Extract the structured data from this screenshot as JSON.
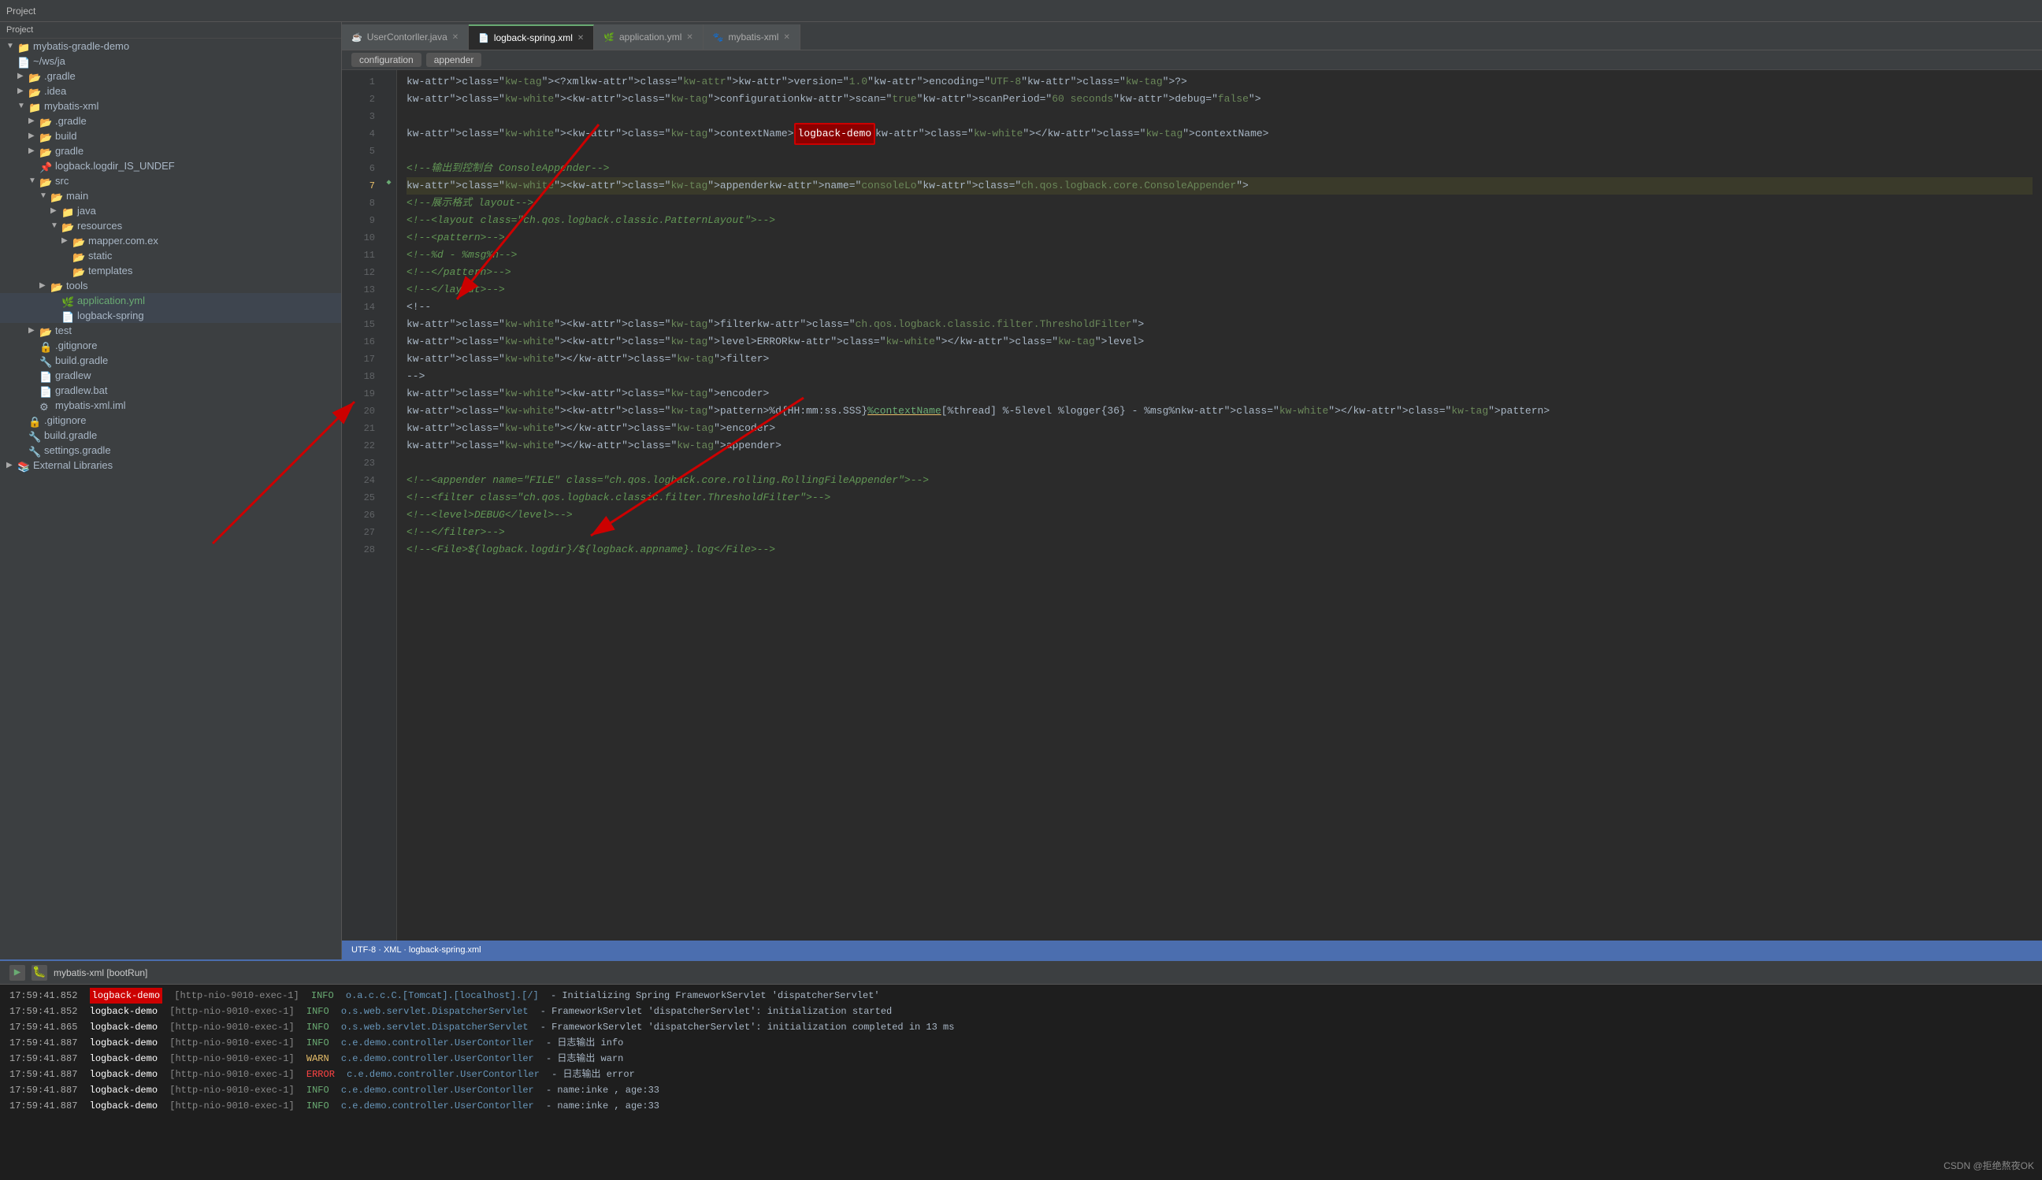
{
  "app": {
    "title": "Project"
  },
  "tabs": [
    {
      "id": "usercontorller",
      "label": "UserContorller.java",
      "icon": "java",
      "active": false
    },
    {
      "id": "logback-spring",
      "label": "logback-spring.xml",
      "icon": "xml",
      "active": true
    },
    {
      "id": "application-yml",
      "label": "application.yml",
      "icon": "yml",
      "active": false
    },
    {
      "id": "mybatis-xml",
      "label": "mybatis-xml",
      "icon": "folder",
      "active": false
    }
  ],
  "breadcrumb": {
    "items": [
      "configuration",
      "appender"
    ]
  },
  "sidebar": {
    "header": "Project",
    "items": [
      {
        "id": "mybatis-gradle-demo",
        "label": "mybatis-gradle-demo",
        "indent": 0,
        "type": "folder-open",
        "icon": "folder-blue",
        "prefix": "▼"
      },
      {
        "id": "ws-ja",
        "label": "~/ws/ja",
        "indent": 0,
        "type": "text",
        "icon": "",
        "prefix": ""
      },
      {
        "id": "gradle-dir",
        "label": ".gradle",
        "indent": 1,
        "type": "folder",
        "icon": "folder",
        "prefix": "▶"
      },
      {
        "id": "idea-dir",
        "label": ".idea",
        "indent": 1,
        "type": "folder",
        "icon": "folder",
        "prefix": "▶"
      },
      {
        "id": "mybatis-xml-dir",
        "label": "mybatis-xml",
        "indent": 1,
        "type": "folder-open",
        "icon": "folder-blue",
        "prefix": "▼"
      },
      {
        "id": "gradle-sub",
        "label": ".gradle",
        "indent": 2,
        "type": "folder",
        "icon": "folder",
        "prefix": "▶"
      },
      {
        "id": "build-sub",
        "label": "build",
        "indent": 2,
        "type": "folder",
        "icon": "folder",
        "prefix": "▶"
      },
      {
        "id": "gradle-sub2",
        "label": "gradle",
        "indent": 2,
        "type": "folder",
        "icon": "folder",
        "prefix": "▶"
      },
      {
        "id": "logback-logdir",
        "label": "logback.logdir_IS_UNDEF",
        "indent": 2,
        "type": "item",
        "icon": "item",
        "prefix": ""
      },
      {
        "id": "src-dir",
        "label": "src",
        "indent": 2,
        "type": "folder-open",
        "icon": "folder",
        "prefix": "▼"
      },
      {
        "id": "main-dir",
        "label": "main",
        "indent": 3,
        "type": "folder-open",
        "icon": "folder",
        "prefix": "▼"
      },
      {
        "id": "java-dir",
        "label": "java",
        "indent": 4,
        "type": "folder-open",
        "icon": "folder-blue",
        "prefix": "▶"
      },
      {
        "id": "resources-dir",
        "label": "resources",
        "indent": 4,
        "type": "folder-open",
        "icon": "folder",
        "prefix": "▼"
      },
      {
        "id": "mapper-dir",
        "label": "mapper.com.ex",
        "indent": 5,
        "type": "folder",
        "icon": "folder",
        "prefix": "▶"
      },
      {
        "id": "static-dir",
        "label": "static",
        "indent": 5,
        "type": "folder",
        "icon": "folder",
        "prefix": ""
      },
      {
        "id": "templates-dir",
        "label": "templates",
        "indent": 5,
        "type": "folder",
        "icon": "folder",
        "prefix": ""
      },
      {
        "id": "tools-dir",
        "label": "tools",
        "indent": 3,
        "type": "folder",
        "icon": "folder",
        "prefix": "▶"
      },
      {
        "id": "application-yml",
        "label": "application.yml",
        "indent": 4,
        "type": "file",
        "icon": "yml",
        "prefix": ""
      },
      {
        "id": "logback-spring-xml",
        "label": "logback-spring",
        "indent": 4,
        "type": "file",
        "icon": "xml",
        "prefix": ""
      },
      {
        "id": "test-dir",
        "label": "test",
        "indent": 2,
        "type": "folder",
        "icon": "folder",
        "prefix": "▶"
      },
      {
        "id": "gitignore",
        "label": ".gitignore",
        "indent": 2,
        "type": "file",
        "icon": "gitignore",
        "prefix": ""
      },
      {
        "id": "build-gradle",
        "label": "build.gradle",
        "indent": 2,
        "type": "file",
        "icon": "gradle",
        "prefix": ""
      },
      {
        "id": "gradlew",
        "label": "gradlew",
        "indent": 2,
        "type": "file",
        "icon": "file",
        "prefix": ""
      },
      {
        "id": "gradlew-bat",
        "label": "gradlew.bat",
        "indent": 2,
        "type": "file",
        "icon": "file",
        "prefix": ""
      },
      {
        "id": "mybatis-xml-iml",
        "label": "mybatis-xml.iml",
        "indent": 2,
        "type": "file",
        "icon": "iml",
        "prefix": ""
      },
      {
        "id": "gitignore2",
        "label": ".gitignore",
        "indent": 1,
        "type": "file",
        "icon": "gitignore",
        "prefix": ""
      },
      {
        "id": "build-gradle2",
        "label": "build.gradle",
        "indent": 1,
        "type": "file",
        "icon": "gradle",
        "prefix": ""
      },
      {
        "id": "settings-gradle",
        "label": "settings.gradle",
        "indent": 1,
        "type": "file",
        "icon": "gradle",
        "prefix": ""
      },
      {
        "id": "external-libs",
        "label": "External Libraries",
        "indent": 0,
        "type": "folder",
        "icon": "lib",
        "prefix": "▶"
      }
    ]
  },
  "code_lines": [
    {
      "num": 1,
      "content": "<?xml version=\"1.0\" encoding=\"UTF-8\"?>",
      "marker": false
    },
    {
      "num": 2,
      "content": "<configuration scan=\"true\" scanPeriod=\"60 seconds\" debug=\"false\">",
      "marker": false
    },
    {
      "num": 3,
      "content": "",
      "marker": false
    },
    {
      "num": 4,
      "content": "    <contextName>logback-demo</contextName>",
      "marker": false
    },
    {
      "num": 5,
      "content": "",
      "marker": false
    },
    {
      "num": 6,
      "content": "    <!--输出到控制台 ConsoleAppender-->",
      "marker": false
    },
    {
      "num": 7,
      "content": "    <appender name=\"consoleLo\" class=\"ch.qos.logback.core.ConsoleAppender\">",
      "marker": true
    },
    {
      "num": 8,
      "content": "        <!--展示格式 layout-->",
      "marker": false
    },
    {
      "num": 9,
      "content": "        <!--<layout class=\"ch.qos.logback.classic.PatternLayout\">-->",
      "marker": false
    },
    {
      "num": 10,
      "content": "            <!--<pattern>-->",
      "marker": false
    },
    {
      "num": 11,
      "content": "                <!--%d - %msg%n-->",
      "marker": false
    },
    {
      "num": 12,
      "content": "            <!--</pattern>-->",
      "marker": false
    },
    {
      "num": 13,
      "content": "        <!--</layout>-->",
      "marker": false
    },
    {
      "num": 14,
      "content": "        <!--",
      "marker": false
    },
    {
      "num": 15,
      "content": "        <filter class=\"ch.qos.logback.classic.filter.ThresholdFilter\">",
      "marker": false
    },
    {
      "num": 16,
      "content": "            <level>ERROR</level>",
      "marker": false
    },
    {
      "num": 17,
      "content": "        </filter>",
      "marker": false
    },
    {
      "num": 18,
      "content": "        -->",
      "marker": false
    },
    {
      "num": 19,
      "content": "        <encoder>",
      "marker": false
    },
    {
      "num": 20,
      "content": "            <pattern>%d{HH:mm:ss.SSS} %contextName [%thread] %-5level %logger{36} - %msg%n</pattern>",
      "marker": false
    },
    {
      "num": 21,
      "content": "        </encoder>",
      "marker": false
    },
    {
      "num": 22,
      "content": "    </appender>",
      "marker": false
    },
    {
      "num": 23,
      "content": "",
      "marker": false
    },
    {
      "num": 24,
      "content": "    <!--<appender name=\"FILE\" class=\"ch.qos.logback.core.rolling.RollingFileAppender\">-->",
      "marker": false
    },
    {
      "num": 25,
      "content": "        <!--<filter class=\"ch.qos.logback.classic.filter.ThresholdFilter\">-->",
      "marker": false
    },
    {
      "num": 26,
      "content": "            <!--<level>DEBUG</level>-->",
      "marker": false
    },
    {
      "num": 27,
      "content": "        <!--</filter>-->",
      "marker": false
    },
    {
      "num": 28,
      "content": "        <!--<File>${logback.logdir}/${logback.appname}.log</File>-->",
      "marker": false
    }
  ],
  "terminal": {
    "title": "mybatis-xml [bootRun]",
    "logs": [
      {
        "time": "17:59:41.852",
        "app": "logback-demo",
        "highlight": true,
        "thread": "[http-nio-9010-exec-1]",
        "level": "INFO",
        "class": "o.a.c.c.C.[Tomcat].[localhost].[/]",
        "msg": "- Initializing Spring FrameworkServlet 'dispatcherServlet'"
      },
      {
        "time": "17:59:41.852",
        "app": "logback-demo",
        "highlight": false,
        "thread": "[http-nio-9010-exec-1]",
        "level": "INFO",
        "class": "o.s.web.servlet.DispatcherServlet",
        "msg": "- FrameworkServlet 'dispatcherServlet': initialization started"
      },
      {
        "time": "17:59:41.865",
        "app": "logback-demo",
        "highlight": false,
        "thread": "[http-nio-9010-exec-1]",
        "level": "INFO",
        "class": "o.s.web.servlet.DispatcherServlet",
        "msg": "- FrameworkServlet 'dispatcherServlet': initialization completed in 13 ms"
      },
      {
        "time": "17:59:41.887",
        "app": "logback-demo",
        "highlight": false,
        "thread": "[http-nio-9010-exec-1]",
        "level": "INFO",
        "class": "c.e.demo.controller.UserContorller",
        "msg": "- 日志输出 info"
      },
      {
        "time": "17:59:41.887",
        "app": "logback-demo",
        "highlight": false,
        "thread": "[http-nio-9010-exec-1]",
        "level": "WARN",
        "class": "c.e.demo.controller.UserContorller",
        "msg": "- 日志输出 warn"
      },
      {
        "time": "17:59:41.887",
        "app": "logback-demo",
        "highlight": false,
        "thread": "[http-nio-9010-exec-1]",
        "level": "ERROR",
        "class": "c.e.demo.controller.UserContorller",
        "msg": "- 日志输出 error"
      },
      {
        "time": "17:59:41.887",
        "app": "logback-demo",
        "highlight": false,
        "thread": "[http-nio-9010-exec-1]",
        "level": "INFO",
        "class": "c.e.demo.controller.UserContorller",
        "msg": "- name:inke , age:33"
      },
      {
        "time": "17:59:41.887",
        "app": "logback-demo",
        "highlight": false,
        "thread": "[http-nio-9010-exec-1]",
        "level": "INFO",
        "class": "c.e.demo.controller.UserContorller",
        "msg": "- name:inke , age:33"
      }
    ]
  },
  "watermark": "CSDN @拒绝熬夜OK"
}
